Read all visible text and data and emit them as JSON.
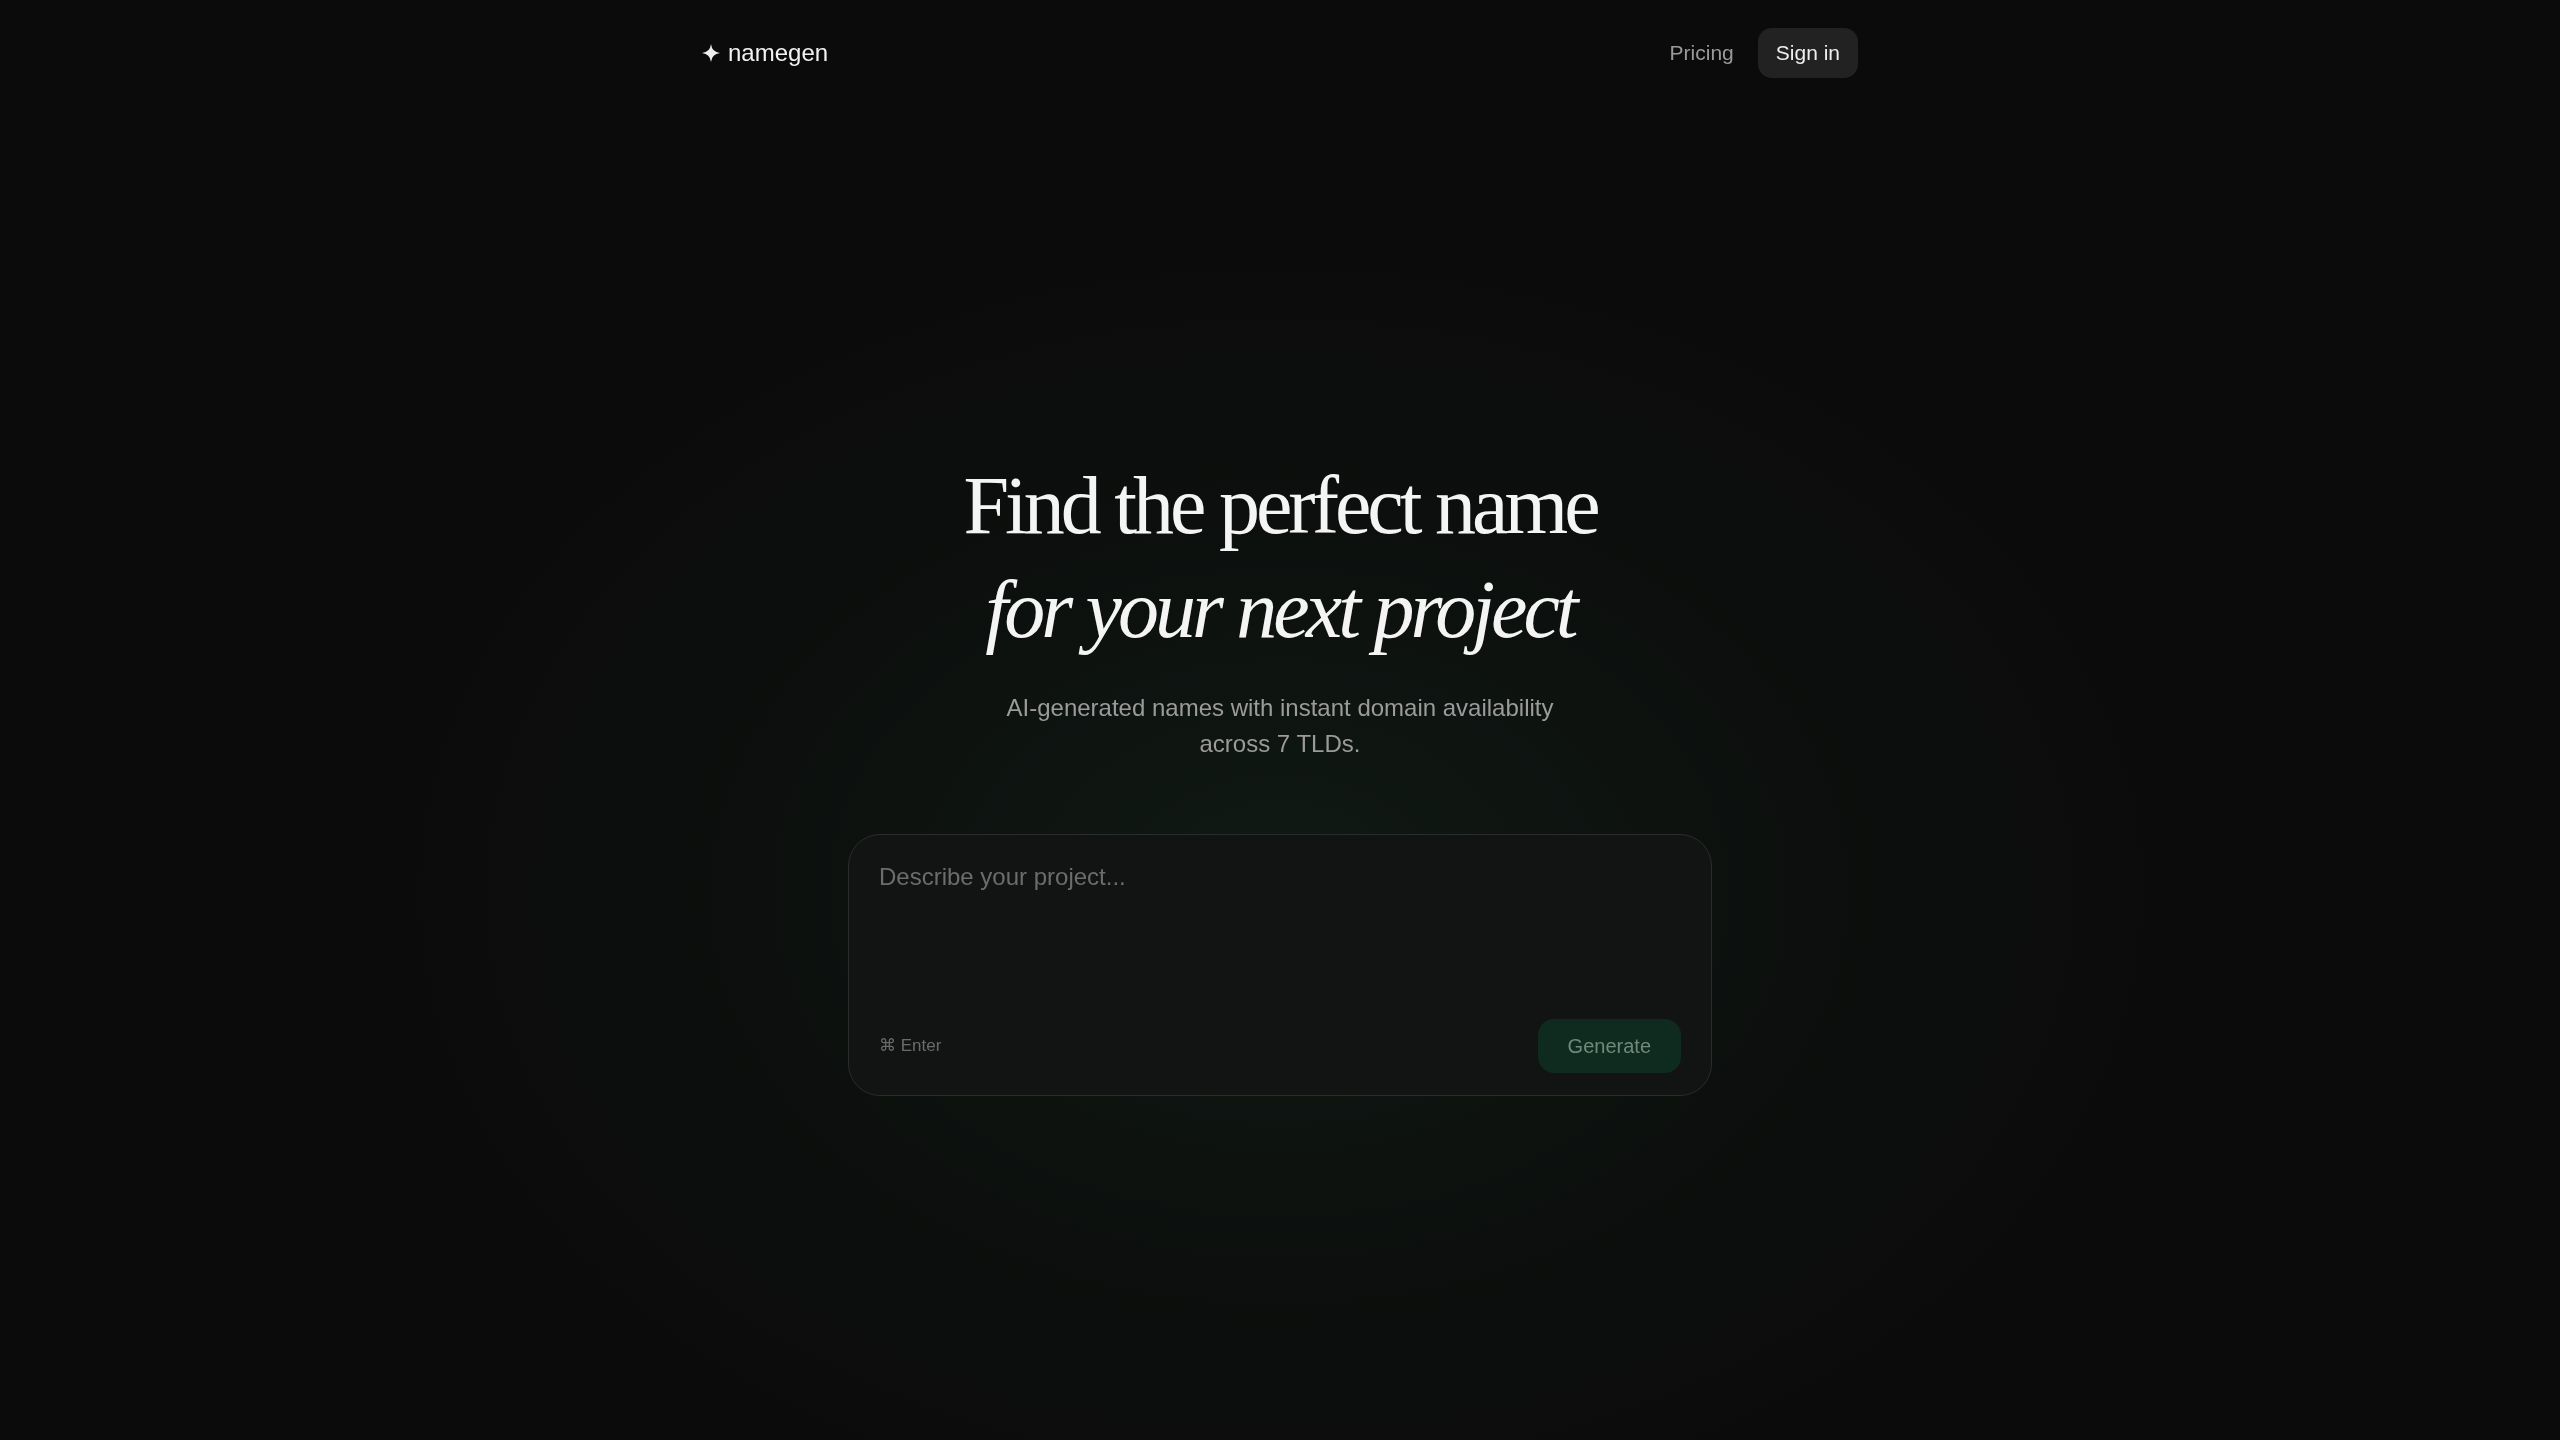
{
  "nav": {
    "brand": "namegen",
    "links": [
      "Pricing"
    ],
    "signin": "Sign in"
  },
  "hero": {
    "title_line1": "Find the perfect name",
    "title_line2": "for your next project",
    "subtitle": "AI-generated names with instant domain availability across 7 TLDs."
  },
  "prompt": {
    "placeholder": "Describe your project...",
    "shortcut": "⌘ Enter",
    "button": {
      "label": "Generate",
      "disabled": true
    }
  }
}
